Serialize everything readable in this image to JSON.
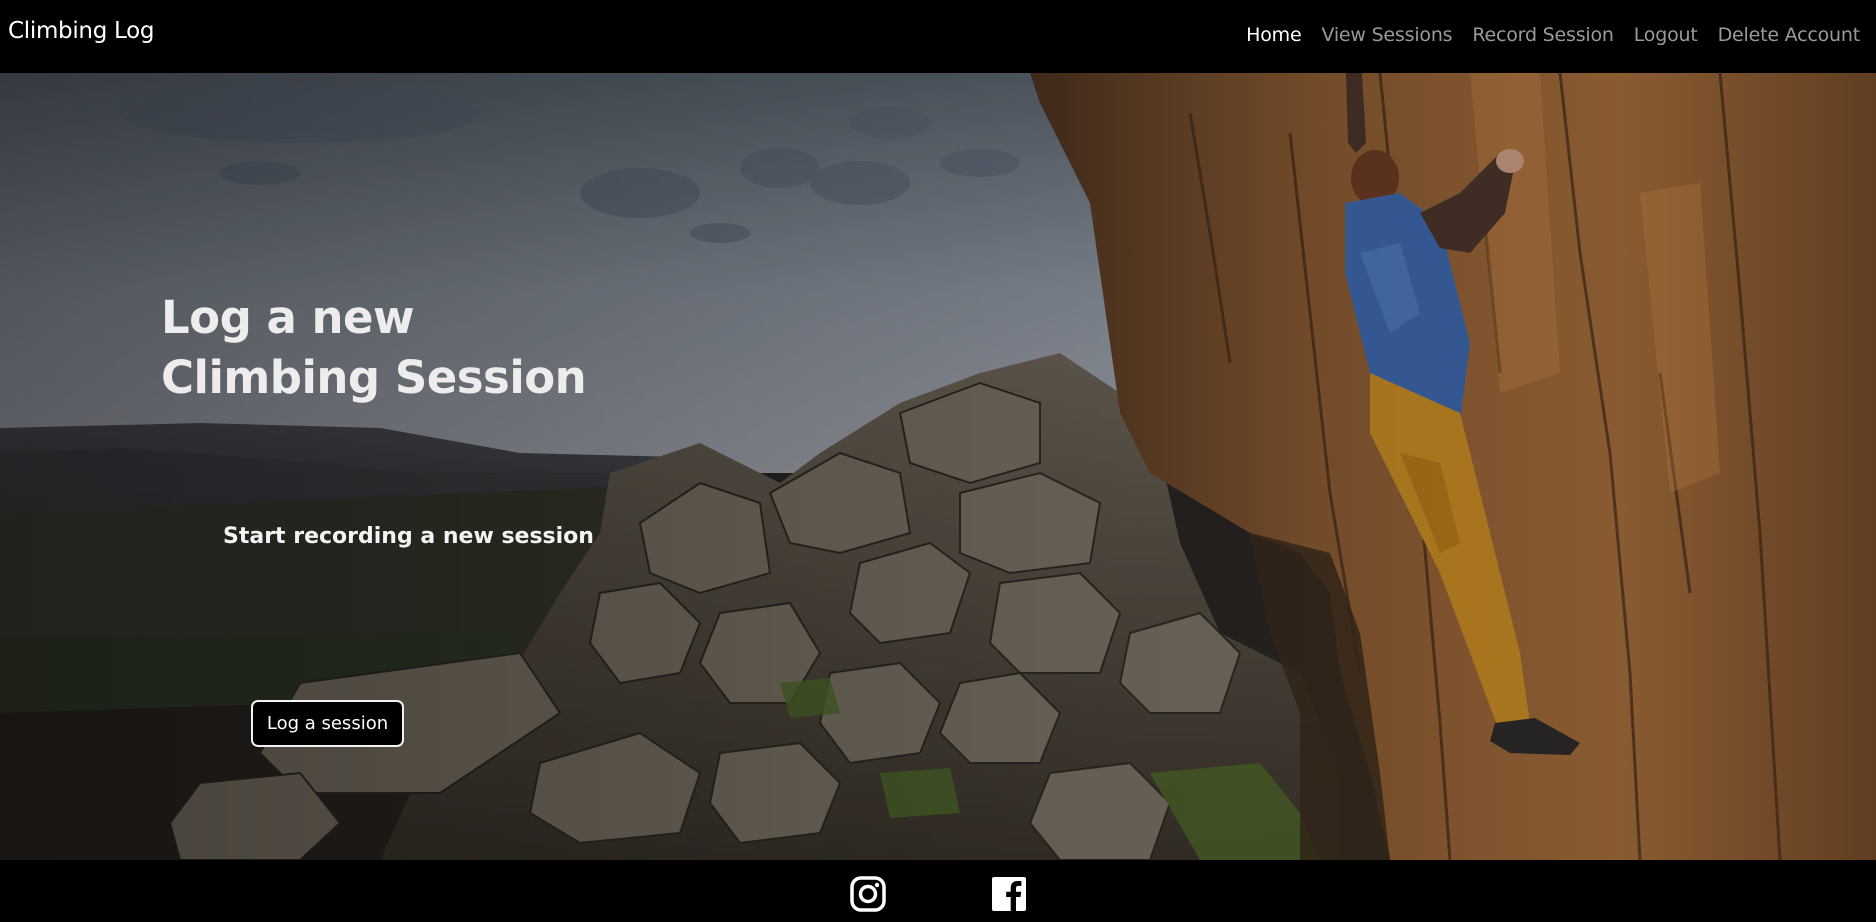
{
  "app": {
    "brand": "Climbing Log"
  },
  "nav": {
    "items": [
      {
        "label": "Home",
        "active": true
      },
      {
        "label": "View Sessions",
        "active": false
      },
      {
        "label": "Record Session",
        "active": false
      },
      {
        "label": "Logout",
        "active": false
      },
      {
        "label": "Delete Account",
        "active": false
      }
    ]
  },
  "hero": {
    "title_line1": "Log a new",
    "title_line2": "Climbing Session",
    "subtitle": "Start recording a new session",
    "button_label": "Log a session",
    "background_description_icon": "climber-on-rock-photo"
  },
  "footer": {
    "social": [
      {
        "icon": "instagram-icon"
      },
      {
        "icon": "facebook-icon"
      }
    ]
  },
  "colors": {
    "navbar_bg": "#000000",
    "nav_active": "#ffffff",
    "nav_inactive": "#9a9a9a",
    "button_bg": "#000000",
    "button_border": "#f2f2f2",
    "rock": "#8a5a32",
    "shirt": "#3f67ab",
    "pants": "#c58a24"
  }
}
